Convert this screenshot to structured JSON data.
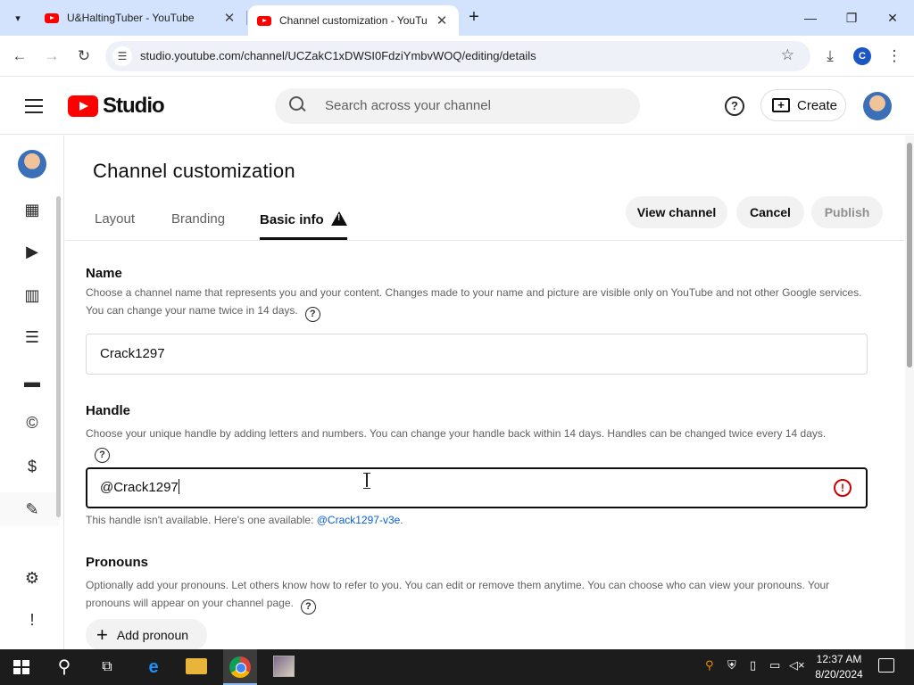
{
  "browser": {
    "tabs": [
      {
        "title": "U&HaltingTuber - YouTube",
        "active": false
      },
      {
        "title": "Channel customization - YouTu",
        "active": true
      }
    ],
    "url": "studio.youtube.com/channel/UCZakC1xDWSI0FdziYmbvWOQ/editing/details",
    "profile_initial": "C"
  },
  "studio": {
    "logo_text": "Studio",
    "search_placeholder": "Search across your channel",
    "create_label": "Create",
    "help_label": "?"
  },
  "nav_icons": [
    "dashboard-icon",
    "content-icon",
    "analytics-icon",
    "comments-icon",
    "subtitles-icon",
    "copyright-icon",
    "earn-icon",
    "customization-icon",
    "audio-library-icon",
    "settings-icon",
    "feedback-icon"
  ],
  "page": {
    "title": "Channel customization",
    "tabs": [
      {
        "label": "Layout",
        "active": false
      },
      {
        "label": "Branding",
        "active": false
      },
      {
        "label": "Basic info",
        "active": true
      }
    ],
    "actions": {
      "view_channel": "View channel",
      "cancel": "Cancel",
      "publish": "Publish"
    },
    "name": {
      "label": "Name",
      "description": "Choose a channel name that represents you and your content. Changes made to your name and picture are visible only on YouTube and not other Google services. You can change your name twice in 14 days.",
      "value": "Crack1297"
    },
    "handle": {
      "label": "Handle",
      "description": "Choose your unique handle by adding letters and numbers. You can change your handle back within 14 days. Handles can be changed twice every 14 days.",
      "value": "@Crack1297",
      "error_text": "This handle isn't available. Here's one available: ",
      "suggestion": "@Crack1297-v3e",
      "error_suffix": "."
    },
    "pronouns": {
      "label": "Pronouns",
      "description": "Optionally add your pronouns. Let others know how to refer to you. You can edit or remove them anytime. You can choose who can view your pronouns. Your pronouns will appear on your channel page.",
      "add_label": "Add pronoun"
    }
  },
  "taskbar": {
    "time": "12:37 AM",
    "date": "8/20/2024"
  },
  "colors": {
    "accent_red": "#ff0000",
    "link_blue": "#065fd4",
    "error_red": "#cc0000"
  }
}
